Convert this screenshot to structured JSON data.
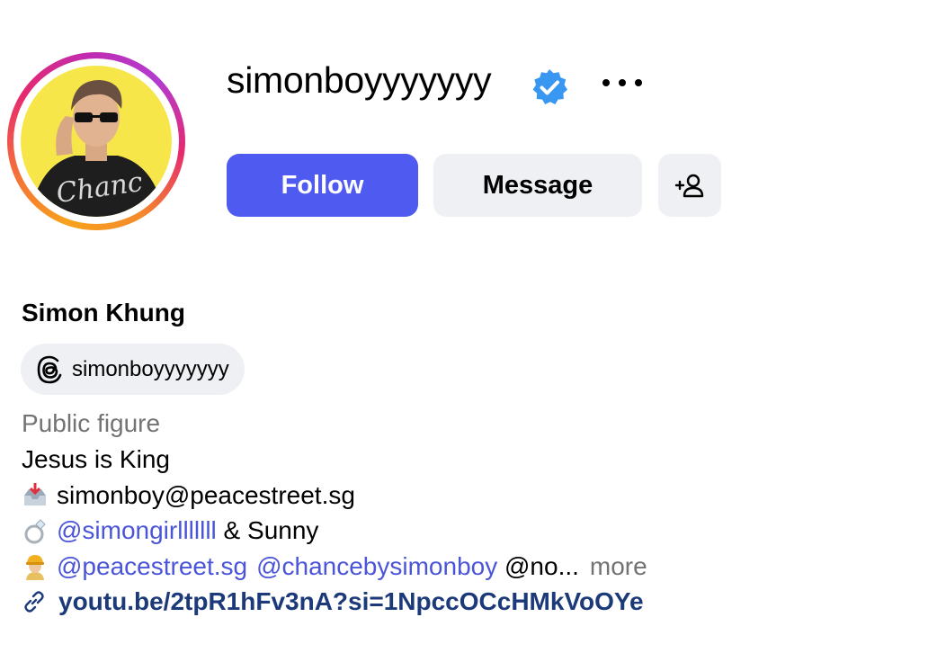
{
  "profile": {
    "username": "simonboyyyyyyy",
    "full_name": "Simon Khung",
    "threads_handle": "simonboyyyyyyy",
    "category": "Public figure",
    "avatar_ring_colors": [
      "#f7a21b",
      "#e6296f",
      "#b33bd0"
    ],
    "avatar_background": "#f7e64a"
  },
  "actions": {
    "follow_label": "Follow",
    "message_label": "Message",
    "more_icon": "ellipsis-icon",
    "add_user_icon": "add-user-icon"
  },
  "bio": {
    "line1": "Jesus is King",
    "email": "simonboy@peacestreet.sg",
    "ring_mention": "@simongirlllllll",
    "ring_rest": " & Sunny",
    "worker_mention1": "@peacestreet.sg",
    "worker_mention2": "@chancebysimonboy",
    "worker_rest": " @no...",
    "more_label": "more",
    "link": "youtu.be/2tpR1hFv3nA?si=1NpccOCcHMkVoOYe"
  },
  "colors": {
    "accent": "#4f5bf0",
    "mention": "#4a55d8",
    "secondary_text": "#737373",
    "button_bg": "#eff0f3",
    "verified": "#3897f0",
    "link": "#1c3a7a"
  }
}
